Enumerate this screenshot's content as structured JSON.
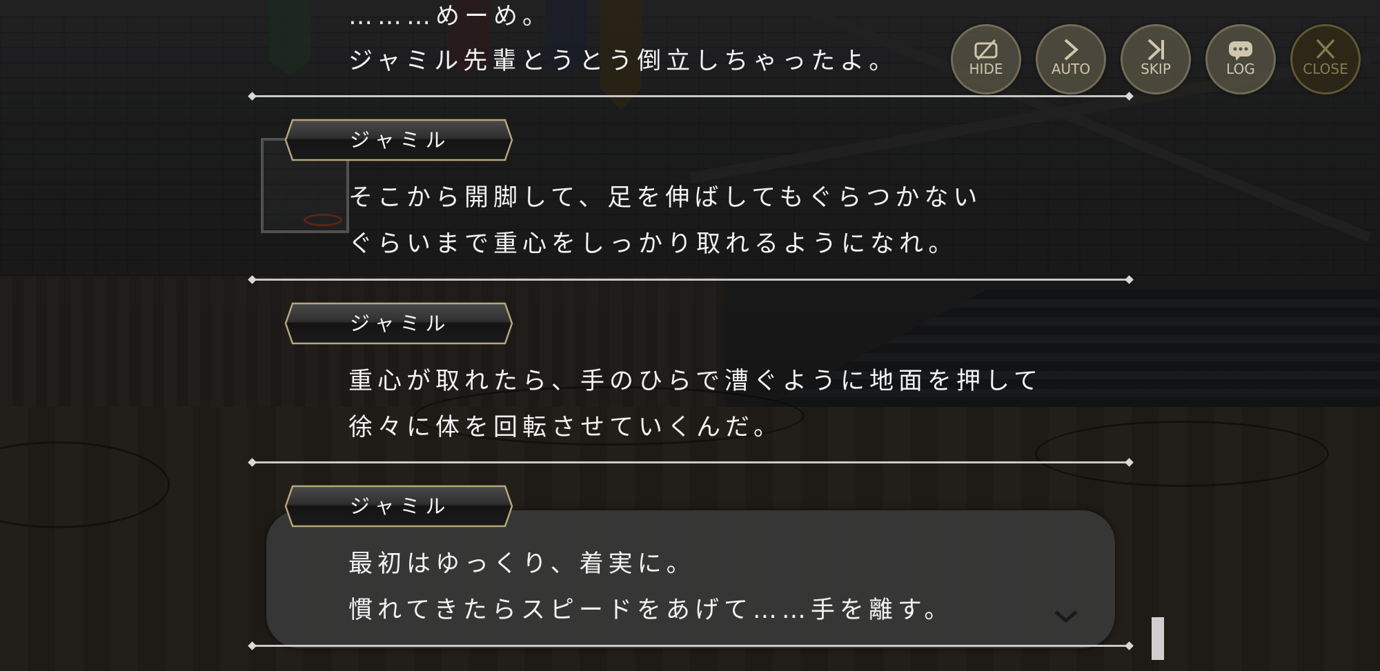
{
  "controls": {
    "hide": "HIDE",
    "auto": "AUTO",
    "skip": "SKIP",
    "log": "LOG",
    "close": "CLOSE"
  },
  "log": {
    "entries": [
      {
        "speaker": "",
        "lines": [
          "………めーめ。",
          "ジャミル先輩とうとう倒立しちゃったよ。"
        ]
      },
      {
        "speaker": "ジャミル",
        "lines": [
          "そこから開脚して、足を伸ばしてもぐらつかない",
          "ぐらいまで重心をしっかり取れるようになれ。"
        ]
      },
      {
        "speaker": "ジャミル",
        "lines": [
          "重心が取れたら、手のひらで漕ぐように地面を押して",
          "徐々に体を回転させていくんだ。"
        ]
      },
      {
        "speaker": "ジャミル",
        "lines": [
          "最初はゆっくり、着実に。",
          "慣れてきたらスピードをあげて……手を離す。"
        ]
      }
    ]
  },
  "icons": {
    "hide": "eye-slash-icon",
    "auto": "play-arrow-icon",
    "skip": "skip-forward-icon",
    "log": "chat-bubble-icon",
    "close": "close-icon",
    "next": "chevron-down-icon"
  },
  "colors": {
    "text": "#f3f3f3",
    "plate_border": "#b8a77a",
    "control_bg": "#5c5846",
    "control_label": "#cfc7ae"
  }
}
